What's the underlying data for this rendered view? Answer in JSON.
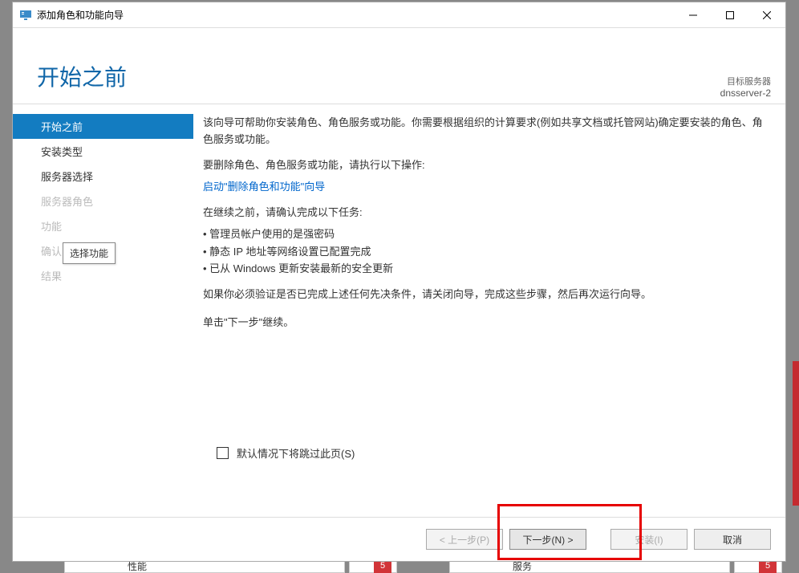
{
  "titlebar": {
    "title": "添加角色和功能向导"
  },
  "header": {
    "pageTitle": "开始之前",
    "targetLabel": "目标服务器",
    "targetServer": "dnsserver-2"
  },
  "sidebar": {
    "items": [
      {
        "label": "开始之前",
        "state": "active"
      },
      {
        "label": "安装类型",
        "state": "normal"
      },
      {
        "label": "服务器选择",
        "state": "normal"
      },
      {
        "label": "服务器角色",
        "state": "disabled"
      },
      {
        "label": "功能",
        "state": "disabled"
      },
      {
        "label": "确认",
        "state": "disabled"
      },
      {
        "label": "结果",
        "state": "disabled"
      }
    ],
    "tooltip": "选择功能"
  },
  "content": {
    "intro": "该向导可帮助你安装角色、角色服务或功能。你需要根据组织的计算要求(例如共享文档或托管网站)确定要安装的角色、角色服务或功能。",
    "removeLabel": "要删除角色、角色服务或功能，请执行以下操作:",
    "removeLink": "启动\"删除角色和功能\"向导",
    "beforeContinue": "在继续之前，请确认完成以下任务:",
    "bullets": [
      "管理员帐户使用的是强密码",
      "静态 IP 地址等网络设置已配置完成",
      "已从 Windows 更新安装最新的安全更新"
    ],
    "verifyNote": "如果你必须验证是否已完成上述任何先决条件，请关闭向导，完成这些步骤，然后再次运行向导。",
    "continueNote": "单击\"下一步\"继续。",
    "skipCheckbox": "默认情况下将跳过此页(S)"
  },
  "footer": {
    "prev": "< 上一步(P)",
    "next": "下一步(N) >",
    "install": "安装(I)",
    "cancel": "取消"
  },
  "background": {
    "left": {
      "badge": "",
      "label": "性能"
    },
    "right": {
      "badge": "5",
      "label": "服务"
    },
    "midBadge": "5"
  }
}
